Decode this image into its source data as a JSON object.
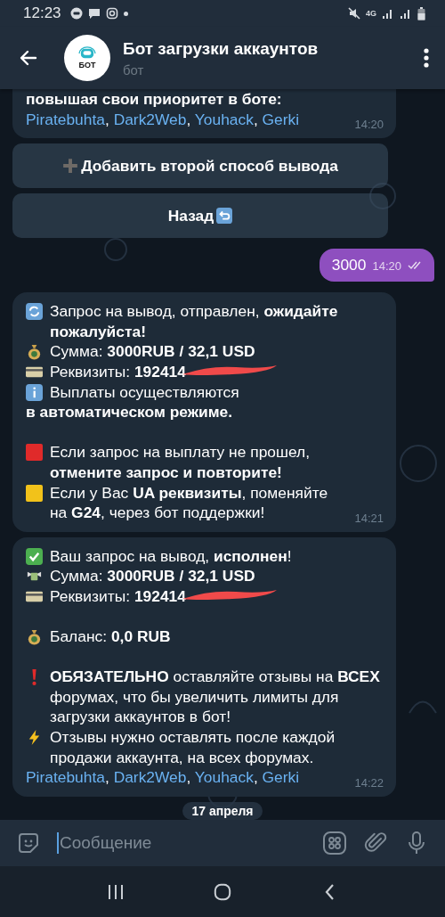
{
  "status_bar": {
    "time": "12:23",
    "network": "4G"
  },
  "header": {
    "title": "Бот загрузки аккаунтов",
    "subtitle": "бот",
    "avatar_text": "БОТ"
  },
  "messages": [
    {
      "kind": "incoming",
      "lines": [
        {
          "kind": "bold",
          "text": "повышая свои приоритет в боте:"
        },
        {
          "kind": "links",
          "links": [
            "Piratebuhta",
            "Dark2Web",
            "Youhack",
            "Gerki"
          ],
          "separator": ", "
        }
      ],
      "time": "14:20"
    },
    {
      "kind": "keyboard",
      "buttons": [
        "Добавить второй способ вывода",
        "Назад"
      ]
    },
    {
      "kind": "outgoing",
      "text": "3000",
      "time": "14:20",
      "read": true
    },
    {
      "kind": "incoming",
      "lines": [
        {
          "kind": "text",
          "text": "Запрос на вывод,  отправлен, **ожидайте пожалуйста!**"
        },
        {
          "kind": "text",
          "text": "Сумма: **3000RUB  / 32,1 USD**"
        },
        {
          "kind": "redacted",
          "text": "Реквизиты: **192414**"
        },
        {
          "kind": "text",
          "text": "Выплаты осуществляются"
        },
        {
          "kind": "bold",
          "text": "в автоматическом режиме."
        },
        {
          "kind": "blank"
        },
        {
          "kind": "text",
          "text": "Если запрос на выплату не прошел, **отмените запрос и повторите!**"
        },
        {
          "kind": "text",
          "text": "Если у Вас **UA реквизиты**, поменяйте на **G24**, через бот поддержки!"
        }
      ],
      "time": "14:21"
    },
    {
      "kind": "incoming",
      "lines": [
        {
          "kind": "text",
          "text": "Ваш запрос на вывод, **исполнен**!"
        },
        {
          "kind": "text",
          "text": "Сумма: **3000RUB  / 32,1 USD**"
        },
        {
          "kind": "redacted",
          "text": "Реквизиты: **192414**"
        },
        {
          "kind": "blank"
        },
        {
          "kind": "text",
          "text": "Баланс: **0,0 RUB**"
        },
        {
          "kind": "blank"
        },
        {
          "kind": "text",
          "text": "**ОБЯЗАТЕЛЬНО** оставляйте отзывы на **ВСЕХ** форумах, что бы увеличить лимиты для загрузки аккаунтов в бот!"
        },
        {
          "kind": "text",
          "text": "Отзывы нужно оставлять после каждой продажи аккаунта, на всех форумах."
        },
        {
          "kind": "links",
          "links": [
            "Piratebuhta",
            "Dark2Web",
            "Youhack",
            "Gerki"
          ],
          "separator": ", "
        }
      ],
      "time": "14:22"
    },
    {
      "kind": "date",
      "text": "17 апреля"
    }
  ],
  "composer": {
    "placeholder": "Сообщение"
  }
}
